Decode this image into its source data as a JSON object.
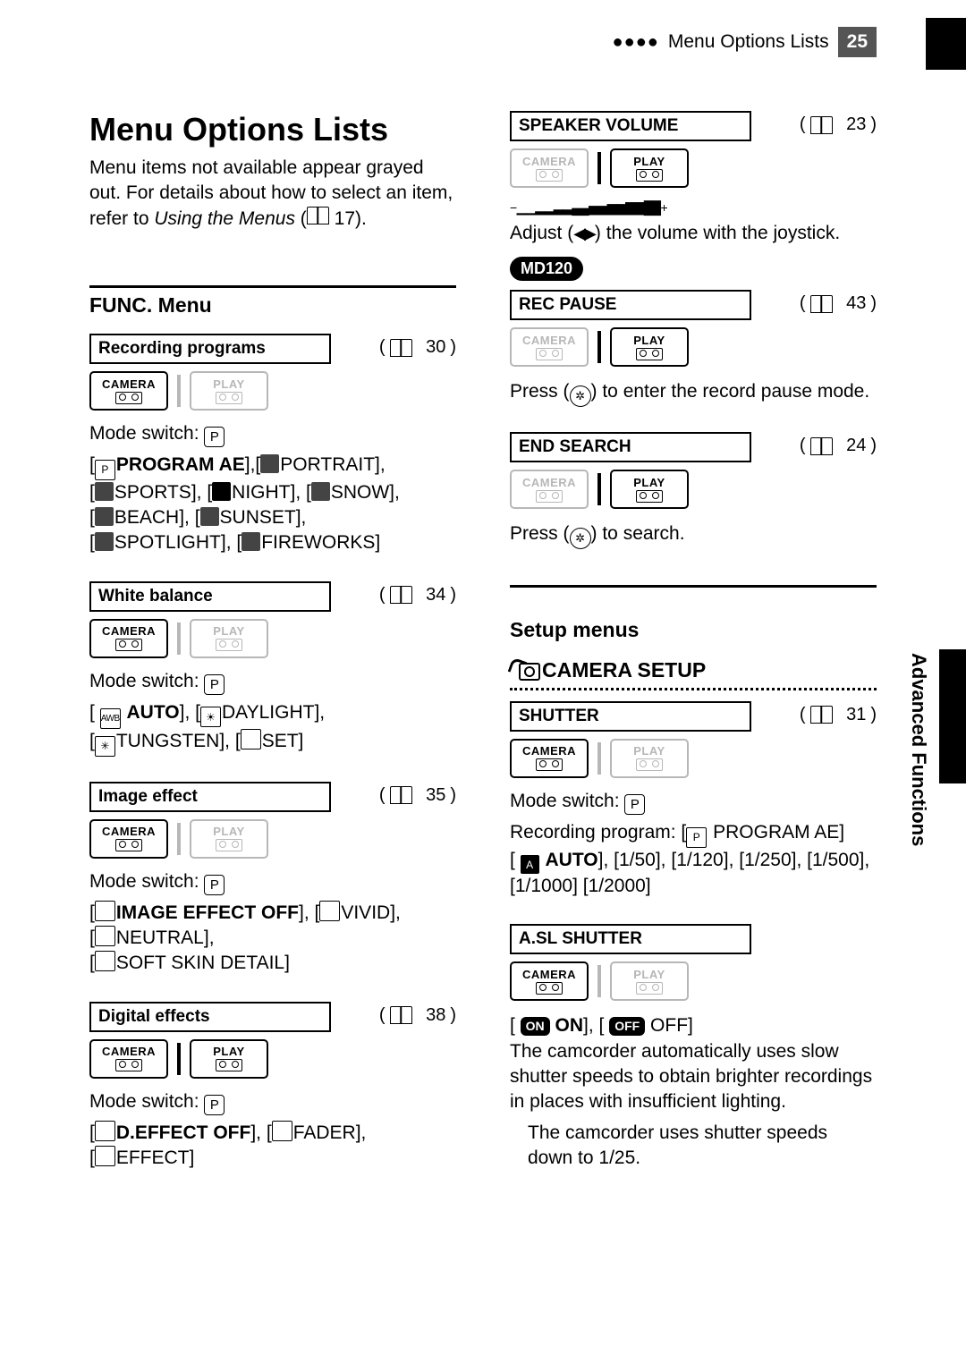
{
  "header": {
    "dots": "●●●●",
    "title": "Menu Options Lists",
    "page": "25"
  },
  "mainTitle": "Menu Options Lists",
  "introPrefix": "Menu items not available appear grayed out. For details about how to select an item, refer to ",
  "introItalic": "Using the Menus",
  "introSuffix": " (",
  "introPage": "17",
  "introClose": ").",
  "funcHeading": "FUNC. Menu",
  "cp": {
    "camera": "CAMERA",
    "play": "PLAY"
  },
  "modeSwitchLabel": "Mode switch:",
  "items": {
    "recPrograms": {
      "label": "Recording programs",
      "page": "30"
    },
    "whiteBalance": {
      "label": "White balance",
      "page": "34"
    },
    "imageEffect": {
      "label": "Image effect",
      "page": "35"
    },
    "digitalEffects": {
      "label": "Digital effects",
      "page": "38"
    },
    "speaker": {
      "label": "SPEAKER VOLUME",
      "page": "23"
    },
    "recPause": {
      "label": "REC PAUSE",
      "page": "43"
    },
    "endSearch": {
      "label": "END SEARCH",
      "page": "24"
    },
    "shutter": {
      "label": "SHUTTER",
      "page": "31"
    },
    "aslShutter": {
      "label": "A.SL SHUTTER"
    }
  },
  "options": {
    "recPrograms": {
      "line1Bold": "PROGRAM AE",
      "line1Rest": "PORTRAIT],",
      "line2": "SPORTS], [",
      "line2b": "NIGHT], [",
      "line2c": "SNOW],",
      "line3a": "BEACH], [",
      "line3b": "SUNSET],",
      "line4a": "SPOTLIGHT], [",
      "line4b": "FIREWORKS]"
    },
    "whiteBalance": {
      "bold": "AUTO",
      "rest1": "DAYLIGHT],",
      "line2a": "TUNGSTEN], [",
      "line2b": "SET]"
    },
    "imageEffect": {
      "bold": "IMAGE EFFECT OFF",
      "rest1": "VIVID],",
      "line2": "NEUTRAL],",
      "line3": "SOFT SKIN DETAIL]"
    },
    "digitalEffects": {
      "bold": "D.EFFECT OFF",
      "rest1": "FADER],",
      "line2": "EFFECT]"
    },
    "shutter": {
      "recProgLabel": "Recording program: [",
      "recProg": "PROGRAM AE]",
      "bold": "AUTO",
      "rest": "], [1/50], [1/120], [1/250], [1/500], [1/1000] [1/2000]"
    },
    "asl": {
      "onBold": "ON",
      "offRest": "OFF]",
      "text": "The camcorder automatically uses slow shutter speeds to obtain brighter recordings in places with insufficient lighting.",
      "note": "The camcorder uses shutter speeds down to 1/25."
    }
  },
  "right": {
    "volBar": "−▁▁▂▂▃▃▄▄▅▅▆▆▇▇██+",
    "speakerText1": "Adjust (",
    "speakerText2": ") the volume with the joystick.",
    "badge": "MD120",
    "recPauseText1": "Press (",
    "recPauseText2": ") to enter the record pause mode.",
    "endSearchText1": "Press (",
    "endSearchText2": ") to search.",
    "setupHeading": "Setup menus",
    "cameraSetup": "CAMERA SETUP",
    "sideLabel": "Advanced Functions"
  }
}
